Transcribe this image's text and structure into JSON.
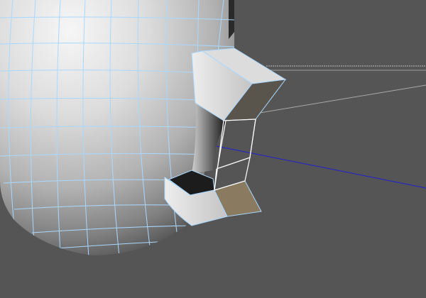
{
  "viewport": {
    "background": "#555555",
    "mesh_wire_color": "#a9d8ff",
    "selection_color": "#ffffff",
    "axis_x_color": "#1f1fd0",
    "ground_line_color": "#b8b8b8",
    "icons": [
      "mesh-object",
      "axis-line",
      "selected-face"
    ]
  }
}
